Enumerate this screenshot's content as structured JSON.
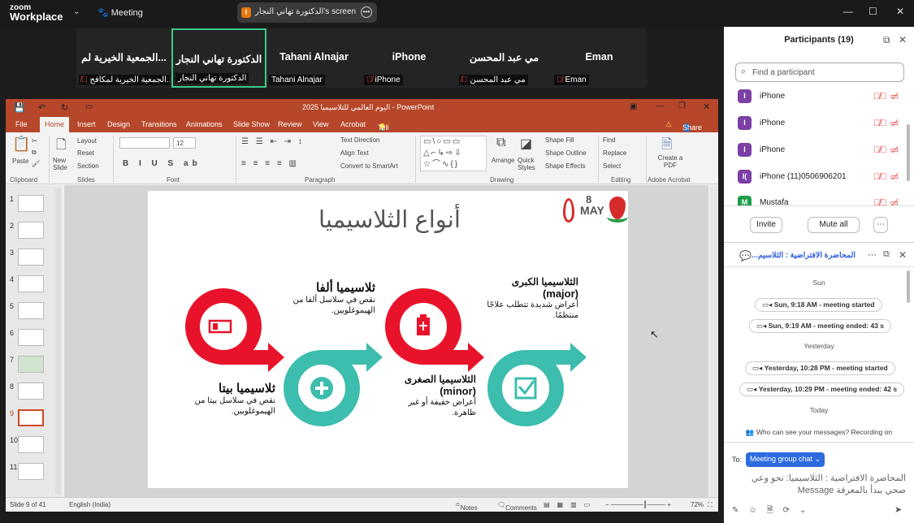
{
  "topbar": {
    "logo_line1": "zoom",
    "logo_line2": "Workplace",
    "meeting_label": "Meeting",
    "screen_badge": "I",
    "screen_title": "الدكتورة تهاني النجار's screen"
  },
  "strip": {
    "tiles": [
      {
        "name": "الجمعية الخيرية لم...",
        "label": "الجمعية الخيرية لمكافح...",
        "muted": true
      },
      {
        "name": "الدكتورة تهاني النجار",
        "label": "الدكتورة تهاني النجار",
        "muted": false,
        "active": true
      },
      {
        "name": "Tahani Alnajar",
        "label": "Tahani Alnajar",
        "muted": false
      },
      {
        "name": "iPhone",
        "label": "iPhone",
        "muted": true
      },
      {
        "name": "مي عبد المحسن",
        "label": "مي عبد المحسن",
        "muted": true
      },
      {
        "name": "Eman",
        "label": "Eman",
        "muted": true
      }
    ]
  },
  "ppt": {
    "title": "اليوم العالمي للثلاسيميا 2025 - PowerPoint",
    "tabs": [
      "File",
      "Home",
      "Insert",
      "Design",
      "Transitions",
      "Animations",
      "Slide Show",
      "Review",
      "View",
      "Acrobat"
    ],
    "tell_me": "Tell me what you want to do...",
    "share": "Share",
    "ribbon": {
      "paste": "Paste",
      "clipboard": "Clipboard",
      "new_slide": "New Slide",
      "layout": "Layout",
      "reset": "Reset",
      "section": "Section",
      "slides": "Slides",
      "font": "Font",
      "font_size": "12",
      "paragraph": "Paragraph",
      "text_direction": "Text Direction",
      "align_text": "Align Text",
      "smartart": "Convert to SmartArt",
      "drawing": "Drawing",
      "arrange": "Arrange",
      "quick_styles": "Quick Styles",
      "shape_fill": "Shape Fill",
      "shape_outline": "Shape Outline",
      "shape_effects": "Shape Effects",
      "find": "Find",
      "replace": "Replace",
      "select": "Select",
      "editing": "Editing",
      "create_pdf": "Create a PDF",
      "adobe": "Adobe Acrobat"
    },
    "slide_numbers": [
      "1",
      "2",
      "3",
      "4",
      "5",
      "6",
      "7",
      "8",
      "9",
      "10",
      "11"
    ],
    "slide": {
      "title": "أنواع الثلاسيميا",
      "logo_day": "8",
      "logo_month": "MAY",
      "alpha_title": "ثلاسيميا ألفا",
      "alpha_desc": "نقص في سلاسل ألفا من الهيموغلوبين.",
      "beta_title": "ثلاسيميا بيتا",
      "beta_desc": "نقص في سلاسل بيتا من الهيموغلوبين.",
      "major_title": "الثلاسيميا الكبرى",
      "major_en": "(major)",
      "major_desc": "أعراض شديدة تتطلب علاجًا منتظمًا.",
      "minor_title": "الثلاسيميا الصغرى",
      "minor_en": "(minor)",
      "minor_desc": "أعراض خفيفة أو غير ظاهرة."
    },
    "status": {
      "slide_of": "Slide 9 of 41",
      "language": "English (India)",
      "notes": "Notes",
      "comments": "Comments",
      "zoom": "72%"
    }
  },
  "participants": {
    "header": "Participants (19)",
    "search_placeholder": "Find a participant",
    "list": [
      {
        "initial": "I",
        "name": "iPhone",
        "color": "#7b3fa5"
      },
      {
        "initial": "I",
        "name": "iPhone",
        "color": "#7b3fa5"
      },
      {
        "initial": "I",
        "name": "iPhone",
        "color": "#7b3fa5"
      },
      {
        "initial": "I(",
        "name": "iPhone (11)0506906201",
        "color": "#7b3fa5"
      },
      {
        "initial": "M",
        "name": "Mustafa",
        "color": "#1e9e4a"
      }
    ],
    "invite": "Invite",
    "mute_all": "Mute all"
  },
  "chat": {
    "title": "المحاضرة الافتراضية : الثلاسيم...",
    "days": [
      "Sun",
      "Yesterday",
      "Today"
    ],
    "events": [
      "Sun, 9:18 AM - meeting started",
      "Sun, 9:19 AM - meeting ended: 43 s",
      "Yesterday, 10:28 PM - meeting started",
      "Yesterday, 10:29 PM - meeting ended: 42 s"
    ],
    "notice": "Who can see your messages? Recording on",
    "to_label": "To:",
    "to_value": "Meeting group chat",
    "input_text": "المحاضرة الافتراضية : الثلاسيميا: نحو وعي صحي يبدأ بالمعرفة Message"
  }
}
